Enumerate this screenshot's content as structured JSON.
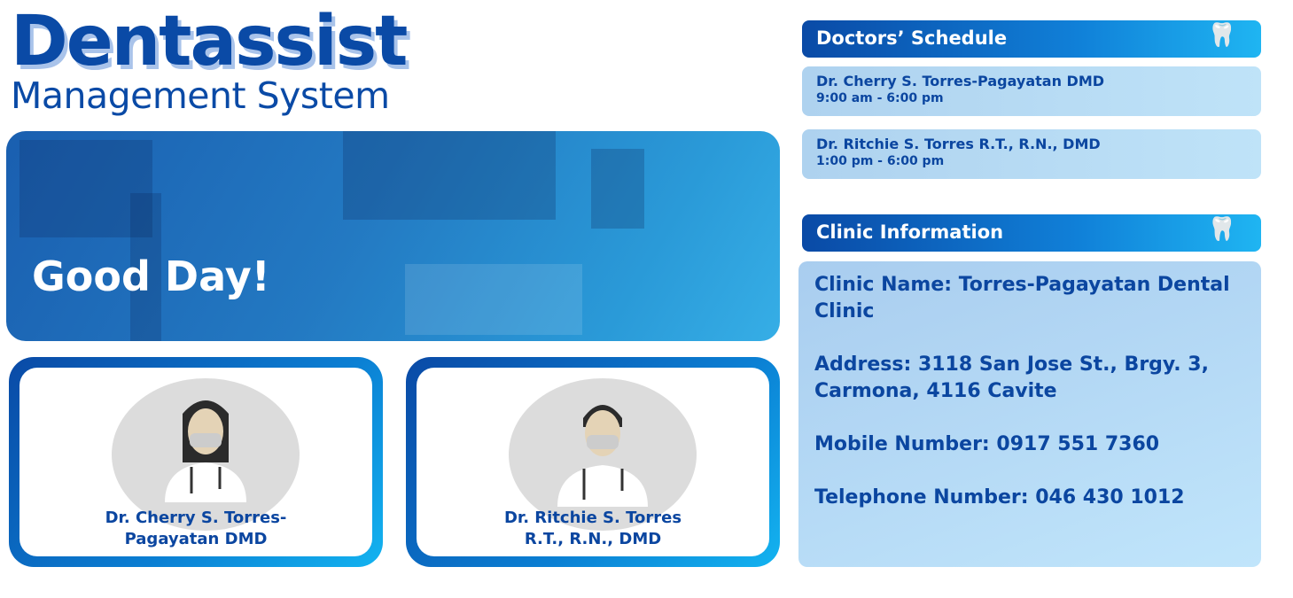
{
  "header": {
    "title": "Dentassist",
    "subtitle": "Management System"
  },
  "banner": {
    "greeting": "Good Day!"
  },
  "doctor_cards": [
    {
      "name_line1": "Dr. Cherry S. Torres-",
      "name_line2": "Pagayatan DMD",
      "avatar": "female-doctor-avatar"
    },
    {
      "name_line1": "Dr. Ritchie S. Torres",
      "name_line2": "R.T., R.N., DMD",
      "avatar": "male-doctor-avatar"
    }
  ],
  "schedule": {
    "title": "Doctors’ Schedule",
    "items": [
      {
        "name": "Dr. Cherry S. Torres-Pagayatan DMD",
        "hours": "9:00 am - 6:00 pm"
      },
      {
        "name": "Dr. Ritchie S. Torres R.T., R.N., DMD",
        "hours": "1:00 pm - 6:00 pm"
      }
    ]
  },
  "clinic": {
    "title": "Clinic Information",
    "name": "Clinic Name: Torres-Pagayatan Dental Clinic",
    "address": "Address: 3118 San Jose St., Brgy. 3, Carmona, 4116 Cavite",
    "mobile": "Mobile Number: 0917 551 7360",
    "telephone": "Telephone Number: 046 430 1012"
  },
  "colors": {
    "primary": "#0a4aa6",
    "accent": "#1fb5f2",
    "panel": "#b7dcf2"
  }
}
